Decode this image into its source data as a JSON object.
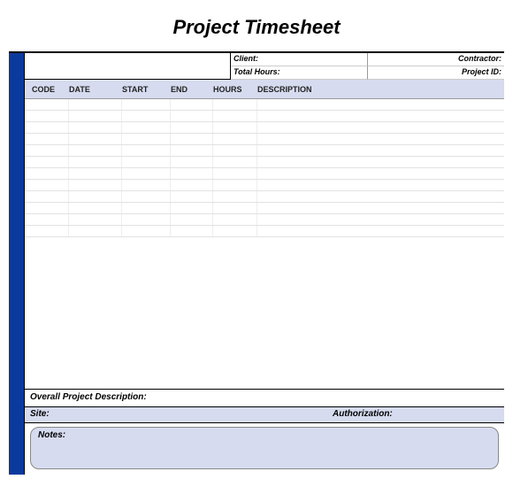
{
  "title": "Project Timesheet",
  "info": {
    "client_label": "Client:",
    "contractor_label": "Contractor:",
    "total_hours_label": "Total Hours:",
    "project_id_label": "Project ID:"
  },
  "columns": {
    "code": "CODE",
    "date": "DATE",
    "start": "START",
    "end": "END",
    "hours": "HOURS",
    "description": "DESCRIPTION"
  },
  "footer": {
    "overall_label": "Overall Project Description:",
    "site_label": "Site:",
    "authorization_label": "Authorization:",
    "notes_label": "Notes:"
  },
  "row_count": 12,
  "colors": {
    "accent_blue": "#0b3a9e",
    "header_fill": "#d6dbef"
  }
}
